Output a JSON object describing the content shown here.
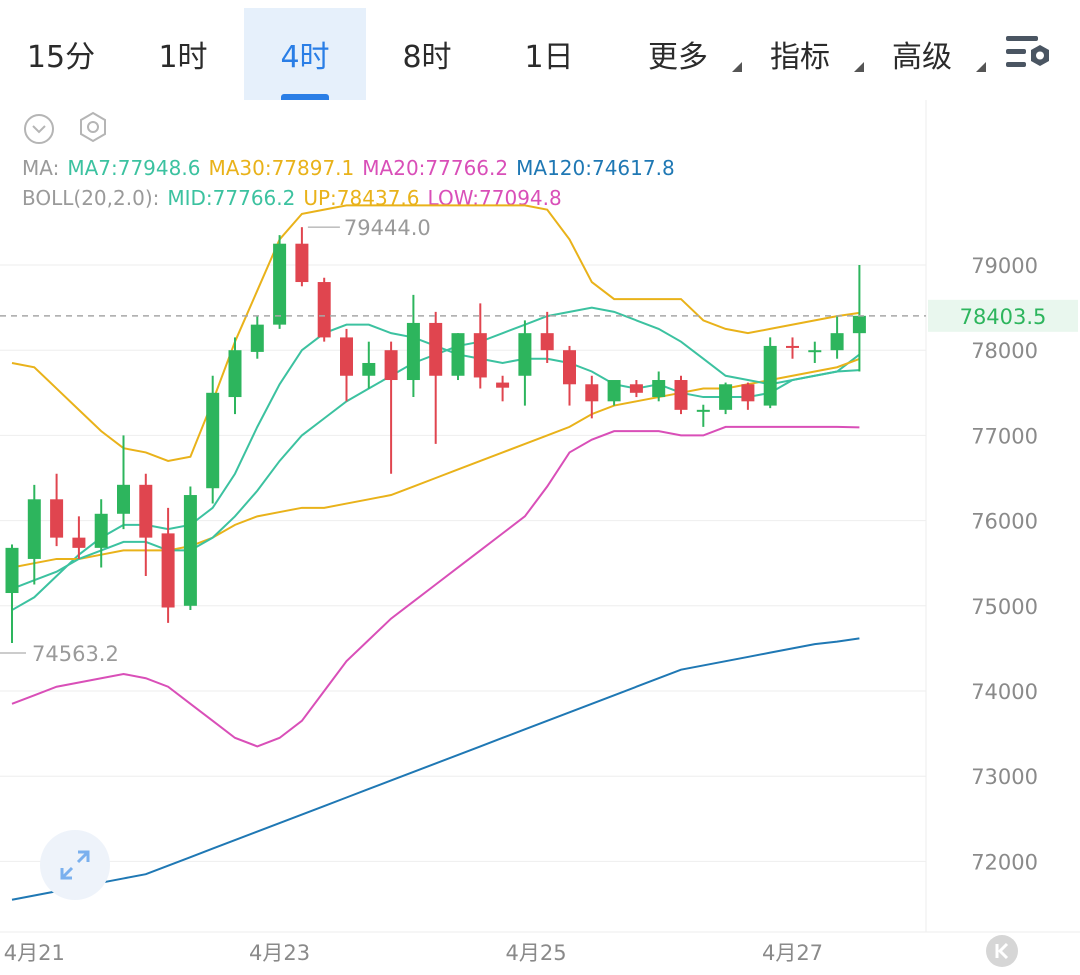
{
  "toolbar": {
    "tabs": [
      {
        "label": "15分",
        "active": false
      },
      {
        "label": "1时",
        "active": false
      },
      {
        "label": "4时",
        "active": true
      },
      {
        "label": "8时",
        "active": false
      },
      {
        "label": "1日",
        "active": false
      }
    ],
    "menus": [
      {
        "label": "更多"
      },
      {
        "label": "指标"
      },
      {
        "label": "高级"
      }
    ],
    "settings_icon": "chart-settings-icon"
  },
  "legend": {
    "ma": {
      "label": "MA:",
      "ma7": "MA7:77948.6",
      "ma30": "MA30:77897.1",
      "ma20": "MA20:77766.2",
      "ma120": "MA120:74617.8"
    },
    "boll": {
      "label": "BOLL(20,2.0):",
      "mid": "MID:77766.2",
      "up": "UP:78437.6",
      "low": "LOW:77094.8"
    }
  },
  "colors": {
    "up": "#2db55d",
    "down": "#e0454f",
    "ma7": "#3cc2a0",
    "ma30": "#e9b21a",
    "ma20": "#d94fb8",
    "ma120": "#1f78b4",
    "accent": "#2a7ee6",
    "grid": "#eeeeee"
  },
  "chart_data": {
    "type": "candlestick",
    "title": "",
    "interval": "4h",
    "ylim": [
      71500,
      79800
    ],
    "y_ticks": [
      72000,
      73000,
      74000,
      75000,
      76000,
      77000,
      78000,
      79000
    ],
    "x_ticks": [
      "4月21",
      "4月23",
      "4月25",
      "4月27"
    ],
    "current_price": 78403.5,
    "high_label": "79444.0",
    "low_label": "74563.2",
    "candles": [
      {
        "o": 75150,
        "h": 75720,
        "l": 74563.2,
        "c": 75680
      },
      {
        "o": 75550,
        "h": 76420,
        "l": 75250,
        "c": 76250
      },
      {
        "o": 76250,
        "h": 76550,
        "l": 75700,
        "c": 75800
      },
      {
        "o": 75800,
        "h": 76050,
        "l": 75550,
        "c": 75680
      },
      {
        "o": 75680,
        "h": 76250,
        "l": 75450,
        "c": 76080
      },
      {
        "o": 76080,
        "h": 77000,
        "l": 75900,
        "c": 76420
      },
      {
        "o": 76420,
        "h": 76550,
        "l": 75350,
        "c": 75800
      },
      {
        "o": 75850,
        "h": 76150,
        "l": 74800,
        "c": 74980
      },
      {
        "o": 75000,
        "h": 76400,
        "l": 74950,
        "c": 76300
      },
      {
        "o": 76380,
        "h": 77700,
        "l": 76200,
        "c": 77500
      },
      {
        "o": 77450,
        "h": 78150,
        "l": 77250,
        "c": 78000
      },
      {
        "o": 77980,
        "h": 78400,
        "l": 77900,
        "c": 78300
      },
      {
        "o": 78300,
        "h": 79350,
        "l": 78250,
        "c": 79250
      },
      {
        "o": 79250,
        "h": 79444.0,
        "l": 78750,
        "c": 78800
      },
      {
        "o": 78800,
        "h": 78850,
        "l": 78100,
        "c": 78150
      },
      {
        "o": 78150,
        "h": 78250,
        "l": 77400,
        "c": 77700
      },
      {
        "o": 77700,
        "h": 78100,
        "l": 77550,
        "c": 77850
      },
      {
        "o": 78000,
        "h": 78100,
        "l": 76550,
        "c": 77650
      },
      {
        "o": 77650,
        "h": 78650,
        "l": 77450,
        "c": 78320
      },
      {
        "o": 78320,
        "h": 78450,
        "l": 76900,
        "c": 77700
      },
      {
        "o": 77700,
        "h": 78200,
        "l": 77650,
        "c": 78200
      },
      {
        "o": 78200,
        "h": 78550,
        "l": 77550,
        "c": 77680
      },
      {
        "o": 77620,
        "h": 77700,
        "l": 77400,
        "c": 77560
      },
      {
        "o": 77700,
        "h": 78350,
        "l": 77350,
        "c": 78200
      },
      {
        "o": 78200,
        "h": 78450,
        "l": 77850,
        "c": 78000
      },
      {
        "o": 78000,
        "h": 78050,
        "l": 77350,
        "c": 77600
      },
      {
        "o": 77600,
        "h": 77700,
        "l": 77200,
        "c": 77400
      },
      {
        "o": 77400,
        "h": 77600,
        "l": 77350,
        "c": 77650
      },
      {
        "o": 77600,
        "h": 77650,
        "l": 77450,
        "c": 77500
      },
      {
        "o": 77450,
        "h": 77750,
        "l": 77400,
        "c": 77650
      },
      {
        "o": 77650,
        "h": 77700,
        "l": 77250,
        "c": 77300
      },
      {
        "o": 77300,
        "h": 77360,
        "l": 77100,
        "c": 77300
      },
      {
        "o": 77300,
        "h": 77620,
        "l": 77250,
        "c": 77600
      },
      {
        "o": 77600,
        "h": 77620,
        "l": 77300,
        "c": 77400
      },
      {
        "o": 77350,
        "h": 78150,
        "l": 77320,
        "c": 78050
      },
      {
        "o": 78050,
        "h": 78150,
        "l": 77900,
        "c": 78030
      },
      {
        "o": 78000,
        "h": 78100,
        "l": 77850,
        "c": 78000
      },
      {
        "o": 78000,
        "h": 78400,
        "l": 77900,
        "c": 78200
      },
      {
        "o": 78200,
        "h": 79000,
        "l": 77750,
        "c": 78403.5
      }
    ],
    "series": [
      {
        "name": "MA7",
        "key": "ma7",
        "values": [
          74950,
          75100,
          75350,
          75600,
          75800,
          75950,
          75950,
          75900,
          75950,
          76150,
          76550,
          77100,
          77600,
          78000,
          78200,
          78300,
          78300,
          78200,
          78150,
          78050,
          77950,
          77900,
          77850,
          77900,
          77900,
          77850,
          77750,
          77600,
          77550,
          77600,
          77500,
          77450,
          77450,
          77450,
          77500,
          77650,
          77700,
          77750,
          77948.6
        ]
      },
      {
        "name": "MA30",
        "key": "ma30",
        "values": [
          75450,
          75500,
          75550,
          75550,
          75600,
          75650,
          75650,
          75650,
          75700,
          75800,
          75950,
          76050,
          76100,
          76150,
          76150,
          76200,
          76250,
          76300,
          76400,
          76500,
          76600,
          76700,
          76800,
          76900,
          77000,
          77100,
          77250,
          77350,
          77400,
          77450,
          77500,
          77550,
          77550,
          77600,
          77650,
          77700,
          77750,
          77800,
          77897.1
        ]
      },
      {
        "name": "BOLL MID",
        "key": "ma7",
        "values": [
          75200,
          75300,
          75400,
          75550,
          75650,
          75750,
          75750,
          75650,
          75650,
          75800,
          76050,
          76350,
          76700,
          77000,
          77200,
          77400,
          77550,
          77700,
          77850,
          77950,
          78050,
          78100,
          78200,
          78300,
          78400,
          78450,
          78500,
          78450,
          78350,
          78250,
          78100,
          77900,
          77700,
          77650,
          77600,
          77650,
          77700,
          77750,
          77766.2
        ]
      },
      {
        "name": "BOLL UP",
        "key": "ma30",
        "values": [
          77850,
          77800,
          77550,
          77300,
          77050,
          76850,
          76800,
          76700,
          76750,
          77400,
          78100,
          78700,
          79300,
          79600,
          79650,
          79700,
          79700,
          79700,
          79700,
          79700,
          79700,
          79700,
          79700,
          79700,
          79650,
          79300,
          78800,
          78600,
          78600,
          78600,
          78600,
          78350,
          78250,
          78200,
          78250,
          78300,
          78350,
          78400,
          78437.6
        ]
      },
      {
        "name": "BOLL LOW",
        "key": "ma20",
        "values": [
          73850,
          73950,
          74050,
          74100,
          74150,
          74200,
          74150,
          74050,
          73850,
          73650,
          73450,
          73350,
          73450,
          73650,
          74000,
          74350,
          74600,
          74850,
          75050,
          75250,
          75450,
          75650,
          75850,
          76050,
          76400,
          76800,
          76950,
          77050,
          77050,
          77050,
          77000,
          77000,
          77100,
          77100,
          77100,
          77100,
          77100,
          77100,
          77094.8
        ]
      },
      {
        "name": "MA120",
        "key": "ma120",
        "values": [
          71550,
          71600,
          71650,
          71700,
          71750,
          71800,
          71850,
          71950,
          72050,
          72150,
          72250,
          72350,
          72450,
          72550,
          72650,
          72750,
          72850,
          72950,
          73050,
          73150,
          73250,
          73350,
          73450,
          73550,
          73650,
          73750,
          73850,
          73950,
          74050,
          74150,
          74250,
          74300,
          74350,
          74400,
          74450,
          74500,
          74550,
          74580,
          74617.8
        ]
      }
    ]
  }
}
